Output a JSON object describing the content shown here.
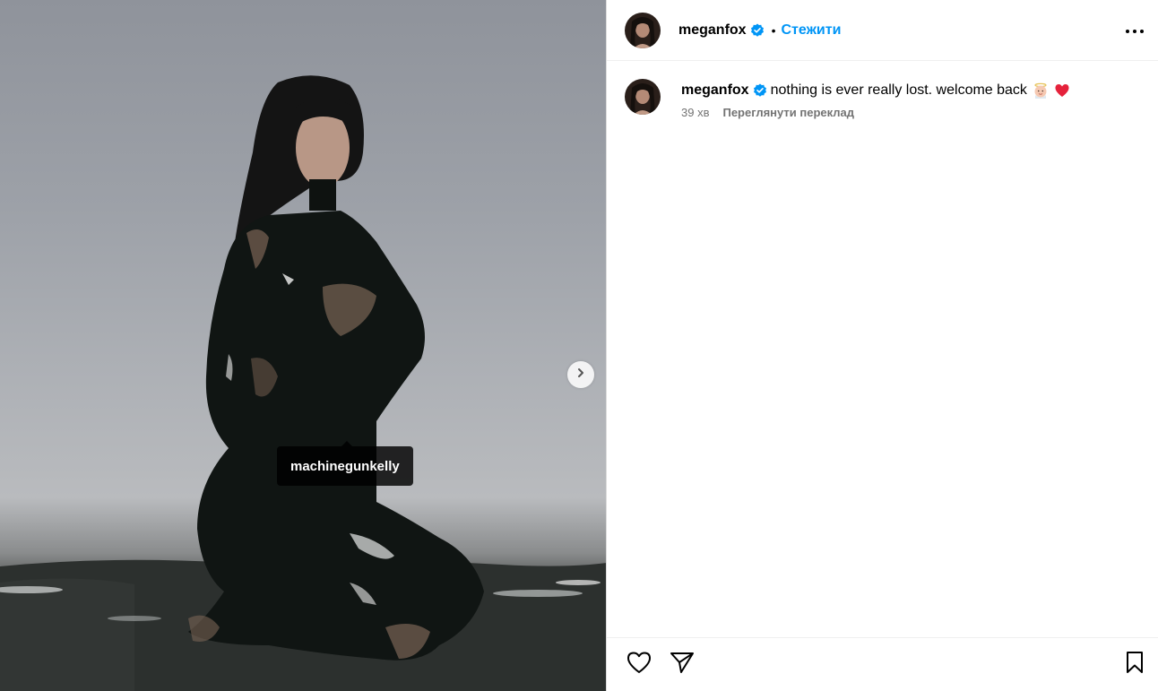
{
  "post": {
    "author": {
      "username": "meganfox",
      "verified": true,
      "follow_label": "Стежити"
    },
    "media": {
      "tag_username": "machinegunkelly",
      "has_next": true
    },
    "caption": {
      "username": "meganfox",
      "text": "nothing is ever really lost. welcome back",
      "emojis": [
        "baby-angel-emoji",
        "red-heart-emoji"
      ],
      "time_ago": "39 хв",
      "see_translation_label": "Переглянути переклад"
    },
    "actions": {
      "icons": [
        "heart-icon",
        "share-icon",
        "bookmark-icon"
      ]
    }
  },
  "colors": {
    "accent": "#0095f6",
    "verified": "#0095f6",
    "muted": "#737373",
    "border": "#dbdbdb"
  }
}
